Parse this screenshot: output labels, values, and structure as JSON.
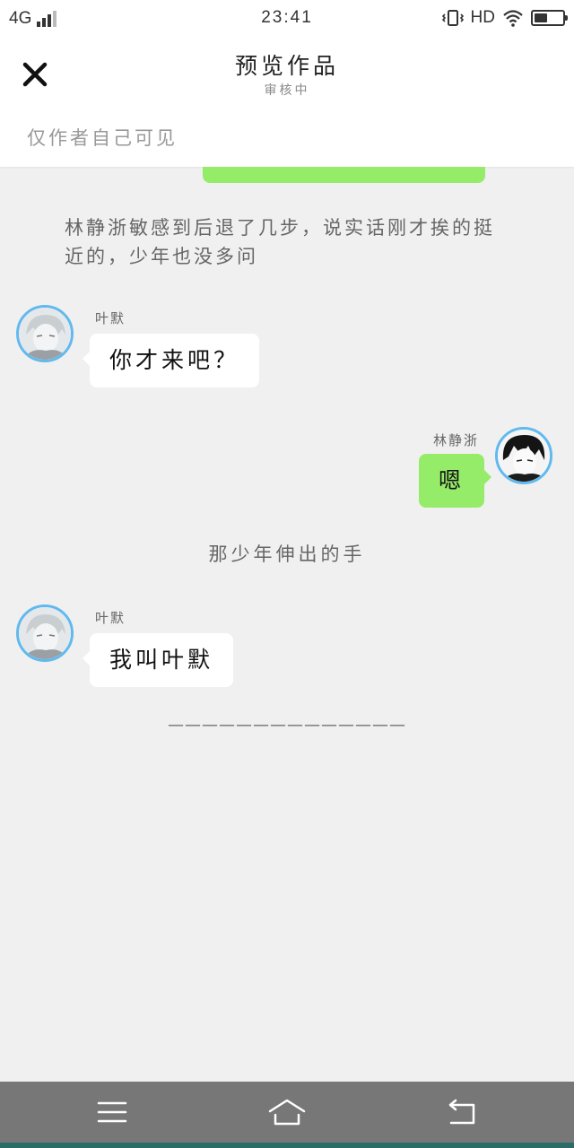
{
  "status_bar": {
    "network": "4G",
    "time": "23:41",
    "hd": "HD",
    "battery_level": 0.45
  },
  "header": {
    "title": "预览作品",
    "subtitle": "审核中",
    "visibility_note": "仅作者自己可见"
  },
  "chat": {
    "narration_1": "林静浙敏感到后退了几步，说实话刚才挨的挺近的，少年也没多问",
    "messages": [
      {
        "speaker": "叶默",
        "text": "你才来吧？",
        "side": "left"
      },
      {
        "speaker": "林静浙",
        "text": "嗯",
        "side": "right"
      },
      {
        "speaker": "叶默",
        "text": "我叫叶默",
        "side": "left"
      }
    ],
    "narration_2": "那少年伸出的手",
    "divider": "——————————————"
  },
  "colors": {
    "bubble_green": "#95ec69",
    "avatar_ring": "#60b9ef",
    "background": "#f0f0f0",
    "navbar": "#777777"
  },
  "icons": {
    "close": "close-icon",
    "menu": "menu-icon",
    "home": "home-icon",
    "back": "back-icon"
  }
}
